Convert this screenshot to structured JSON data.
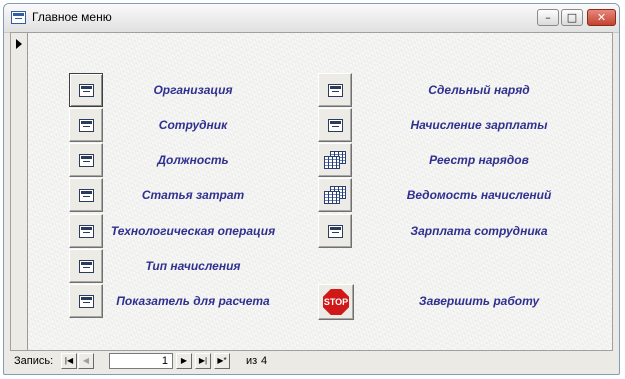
{
  "window": {
    "title": "Главное меню",
    "icon": "form-icon",
    "controls": {
      "minimize": "–",
      "maximize": "□",
      "close": "✕"
    }
  },
  "record_selector": {
    "icon": "current-record-arrow-icon"
  },
  "menu": {
    "left": [
      {
        "id": "organizatsiya",
        "label": "Организация",
        "icon": "form-icon"
      },
      {
        "id": "sotrudnik",
        "label": "Сотрудник",
        "icon": "form-icon"
      },
      {
        "id": "dolzhnost",
        "label": "Должность",
        "icon": "form-icon"
      },
      {
        "id": "statya-zatrat",
        "label": "Статья затрат",
        "icon": "form-icon"
      },
      {
        "id": "tekhnologicheskaya-operatsiya",
        "label": "Технологическая операция",
        "icon": "form-icon"
      },
      {
        "id": "tip-nachisleniya",
        "label": "Тип начисления",
        "icon": "form-icon"
      },
      {
        "id": "pokazatel-dlya-rascheta",
        "label": "Показатель для расчета",
        "icon": "form-icon"
      }
    ],
    "right": [
      {
        "id": "sdelny-naryad",
        "label": "Сдельный наряд",
        "icon": "form-icon"
      },
      {
        "id": "nachislenie-zarplaty",
        "label": "Начисление зарплаты",
        "icon": "form-icon"
      },
      {
        "id": "reestr-naryadov",
        "label": "Реестр нарядов",
        "icon": "report-icon"
      },
      {
        "id": "vedomost-nachisleniy",
        "label": "Ведомость начислений",
        "icon": "report-icon"
      },
      {
        "id": "zarplata-sotrudnika",
        "label": "Зарплата сотрудника",
        "icon": "form-icon"
      },
      {
        "id": "zavershit-rabotu",
        "label": "Завершить работу",
        "icon": "stop-icon",
        "icon_text": "STOP"
      }
    ]
  },
  "navigation": {
    "record_label": "Запись:",
    "first": "|◀",
    "prev": "◀",
    "current": "1",
    "next": "▶",
    "last": "▶|",
    "new": "▶*",
    "of_label": "из",
    "total": "4"
  },
  "colors": {
    "label_text": "#303090",
    "stop_red": "#d01818",
    "close_button": "#c3432f"
  }
}
